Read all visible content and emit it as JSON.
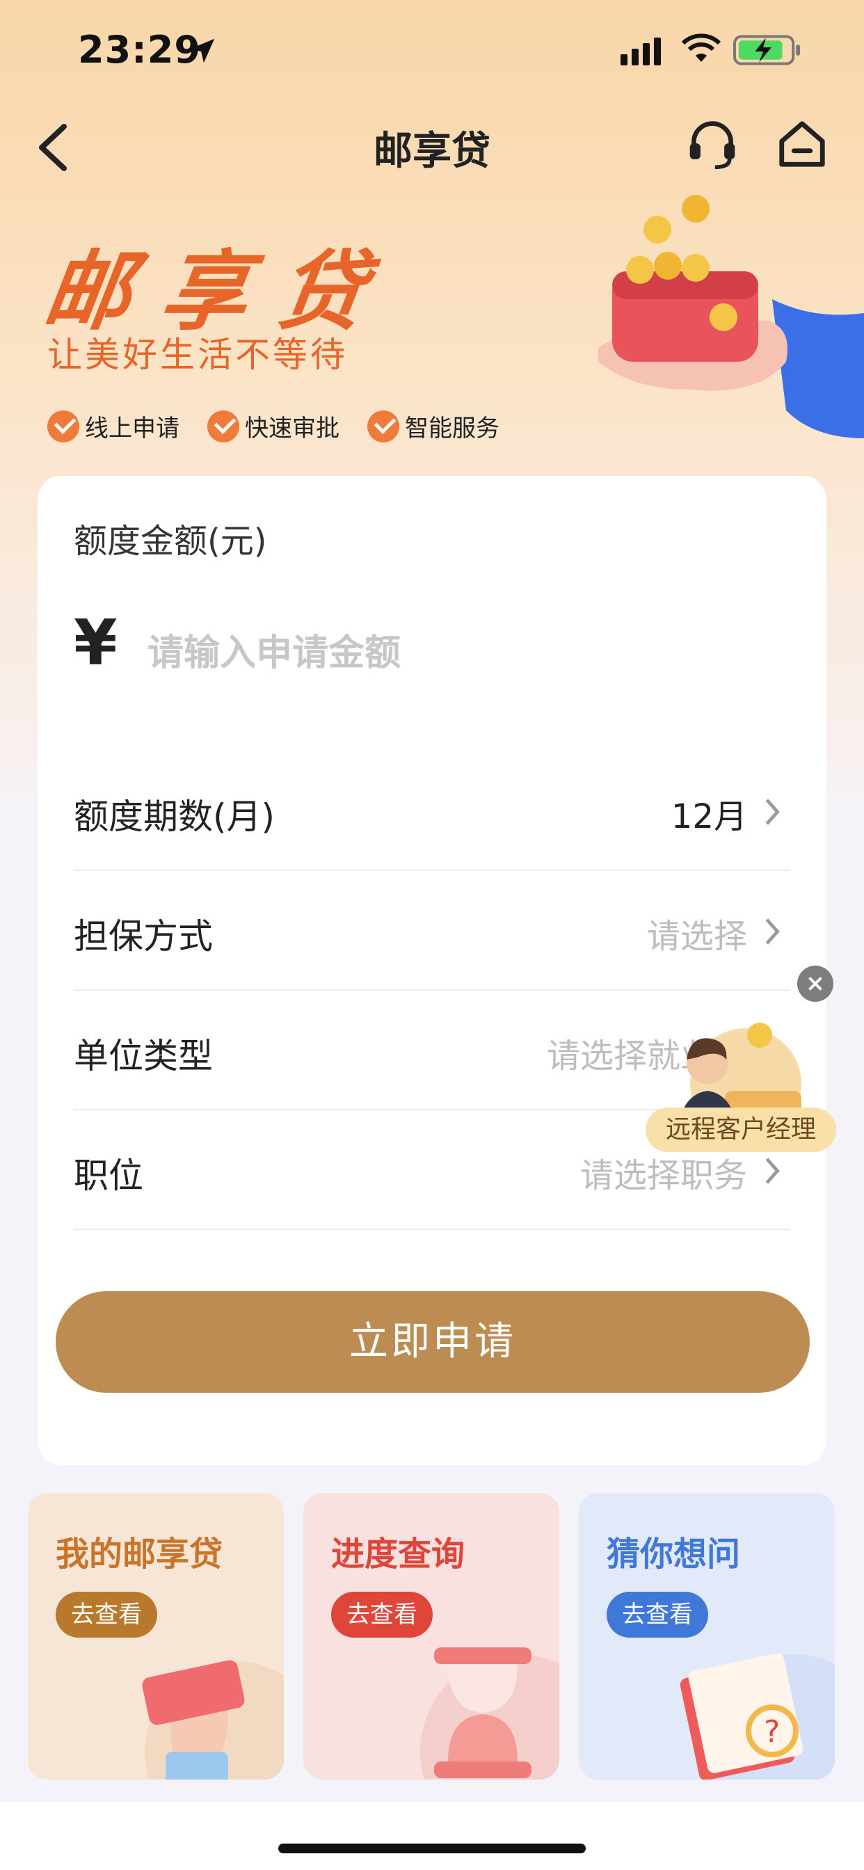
{
  "status_bar": {
    "time": "23:29"
  },
  "nav": {
    "title": "邮享贷"
  },
  "hero": {
    "title": "邮享贷",
    "subtitle": "让美好生活不等待",
    "features": [
      "线上申请",
      "快速审批",
      "智能服务"
    ]
  },
  "form": {
    "amount_label": "额度金额(元)",
    "currency_symbol": "¥",
    "amount_placeholder": "请输入申请金额",
    "rows": [
      {
        "label": "额度期数(月)",
        "value": "12月"
      },
      {
        "label": "担保方式",
        "value": "请选择"
      },
      {
        "label": "单位类型",
        "value": "请选择就业类"
      },
      {
        "label": "职位",
        "value": "请选择职务"
      }
    ],
    "apply_label": "立即申请"
  },
  "float_widget": {
    "label": "远程客户经理"
  },
  "tiles": [
    {
      "title": "我的邮享贷",
      "button": "去查看",
      "title_color": "#c8742a",
      "button_color": "#b9792c",
      "bg": "#f7e6d6"
    },
    {
      "title": "进度查询",
      "button": "去查看",
      "title_color": "#e0453a",
      "button_color": "#e0453a",
      "bg": "#f9e1df"
    },
    {
      "title": "猜你想问",
      "button": "去查看",
      "title_color": "#3f78d8",
      "button_color": "#3f78d8",
      "bg": "#e2e9f9"
    }
  ],
  "colors": {
    "accent": "#e8652a",
    "apply_button": "#bc8c52"
  }
}
